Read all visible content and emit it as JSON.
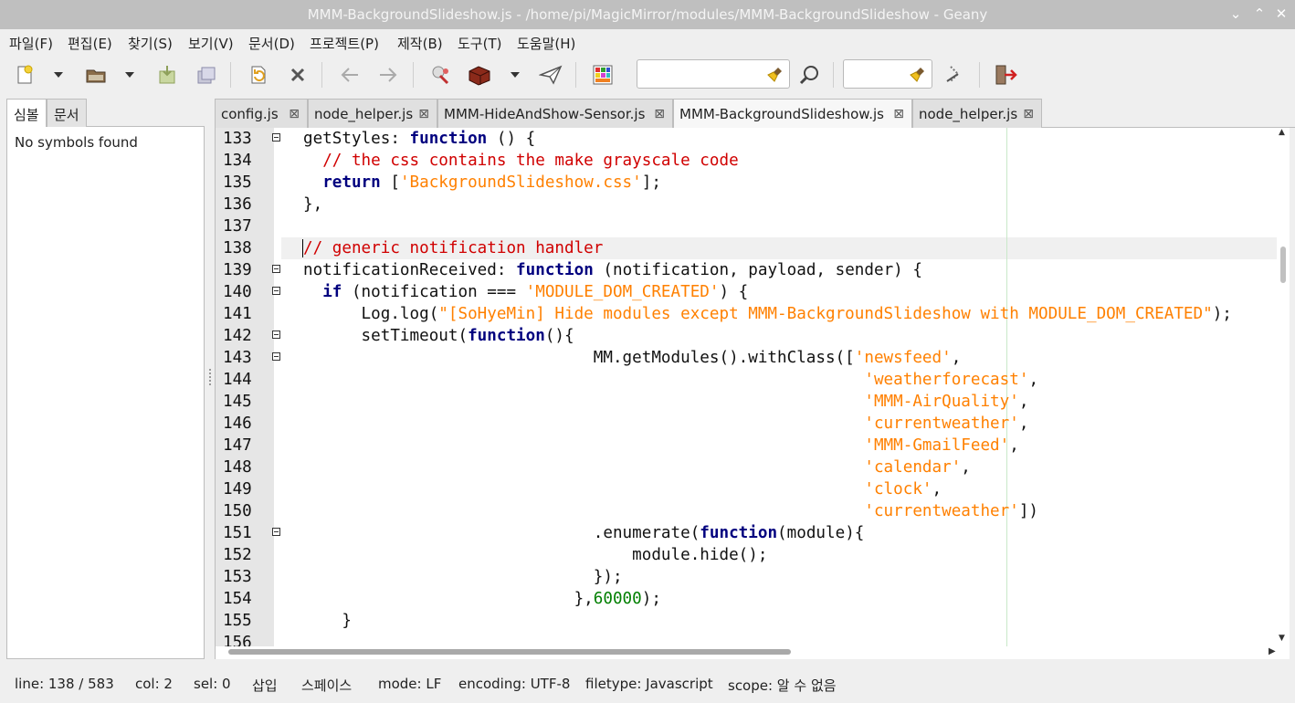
{
  "window": {
    "title": "MMM-BackgroundSlideshow.js - /home/pi/MagicMirror/modules/MMM-BackgroundSlideshow - Geany",
    "minimize_glyph": "⌄",
    "maximize_glyph": "⌃",
    "close_glyph": "✕"
  },
  "menu": [
    "파일(F)",
    "편집(E)",
    "찾기(S)",
    "보기(V)",
    "문서(D)",
    "프로젝트(P)",
    "제작(B)",
    "도구(T)",
    "도움말(H)"
  ],
  "toolbar": {
    "icons": [
      "new-file-icon",
      "dropdown-icon",
      "open-file-icon",
      "dropdown-icon",
      "save-icon",
      "save-all-icon",
      "revert-icon",
      "close-icon",
      "back-icon",
      "forward-icon",
      "compile-icon",
      "build-icon",
      "dropdown-icon",
      "execute-icon",
      "color-chooser-icon",
      "search-icon",
      "jump-to-line-icon",
      "quit-icon"
    ],
    "search_value": "",
    "goto_value": ""
  },
  "sidebar": {
    "tabs": [
      "심볼",
      "문서"
    ],
    "active_tab": 0,
    "empty_text": "No symbols found"
  },
  "tabs": [
    {
      "label": "config.js",
      "active": false
    },
    {
      "label": "node_helper.js",
      "active": false
    },
    {
      "label": "MMM-HideAndShow-Sensor.js",
      "active": false
    },
    {
      "label": "MMM-BackgroundSlideshow.js",
      "active": true
    },
    {
      "label": "node_helper.js",
      "active": false
    }
  ],
  "tab_close_glyph": "⊠",
  "editor": {
    "current_line": 138,
    "lines": [
      {
        "n": "133",
        "fold": true,
        "tokens": [
          [
            "",
            "getStyles: "
          ],
          [
            "kw",
            "function"
          ],
          [
            "",
            " () {"
          ]
        ]
      },
      {
        "n": "134",
        "fold": false,
        "tokens": [
          [
            "",
            "  "
          ],
          [
            "cm",
            "// the css contains the make grayscale code"
          ]
        ]
      },
      {
        "n": "135",
        "fold": false,
        "tokens": [
          [
            "",
            "  "
          ],
          [
            "kw",
            "return"
          ],
          [
            "",
            " ["
          ],
          [
            "st",
            "'BackgroundSlideshow.css'"
          ],
          [
            "",
            "];"
          ]
        ]
      },
      {
        "n": "136",
        "fold": false,
        "tokens": [
          [
            "",
            "},"
          ]
        ]
      },
      {
        "n": "137",
        "fold": false,
        "tokens": [
          [
            "",
            ""
          ]
        ]
      },
      {
        "n": "138",
        "fold": false,
        "tokens": [
          [
            "cm",
            "// generic notification handler"
          ]
        ]
      },
      {
        "n": "139",
        "fold": true,
        "tokens": [
          [
            "",
            "notificationReceived: "
          ],
          [
            "kw",
            "function"
          ],
          [
            "",
            " (notification, payload, sender) {"
          ]
        ]
      },
      {
        "n": "140",
        "fold": true,
        "tokens": [
          [
            "",
            "  "
          ],
          [
            "kw",
            "if"
          ],
          [
            "",
            " (notification === "
          ],
          [
            "st",
            "'MODULE_DOM_CREATED'"
          ],
          [
            "",
            ") {"
          ]
        ]
      },
      {
        "n": "141",
        "fold": false,
        "tokens": [
          [
            "",
            "      Log.log("
          ],
          [
            "st",
            "\"[SoHyeMin] Hide modules except MMM-BackgroundSlideshow with MODULE_DOM_CREATED\""
          ],
          [
            "",
            ");"
          ]
        ]
      },
      {
        "n": "142",
        "fold": true,
        "tokens": [
          [
            "",
            "      setTimeout("
          ],
          [
            "kw",
            "function"
          ],
          [
            "",
            "(){"
          ]
        ]
      },
      {
        "n": "143",
        "fold": true,
        "tokens": [
          [
            "",
            "                              MM.getModules().withClass(["
          ],
          [
            "st",
            "'newsfeed'"
          ],
          [
            "",
            ","
          ]
        ]
      },
      {
        "n": "144",
        "fold": false,
        "tokens": [
          [
            "",
            "                                                          "
          ],
          [
            "st",
            "'weatherforecast'"
          ],
          [
            "",
            ","
          ]
        ]
      },
      {
        "n": "145",
        "fold": false,
        "tokens": [
          [
            "",
            "                                                          "
          ],
          [
            "st",
            "'MMM-AirQuality'"
          ],
          [
            "",
            ","
          ]
        ]
      },
      {
        "n": "146",
        "fold": false,
        "tokens": [
          [
            "",
            "                                                          "
          ],
          [
            "st",
            "'currentweather'"
          ],
          [
            "",
            ","
          ]
        ]
      },
      {
        "n": "147",
        "fold": false,
        "tokens": [
          [
            "",
            "                                                          "
          ],
          [
            "st",
            "'MMM-GmailFeed'"
          ],
          [
            "",
            ","
          ]
        ]
      },
      {
        "n": "148",
        "fold": false,
        "tokens": [
          [
            "",
            "                                                          "
          ],
          [
            "st",
            "'calendar'"
          ],
          [
            "",
            ","
          ]
        ]
      },
      {
        "n": "149",
        "fold": false,
        "tokens": [
          [
            "",
            "                                                          "
          ],
          [
            "st",
            "'clock'"
          ],
          [
            "",
            ","
          ]
        ]
      },
      {
        "n": "150",
        "fold": false,
        "tokens": [
          [
            "",
            "                                                          "
          ],
          [
            "st",
            "'currentweather'"
          ],
          [
            "",
            "])"
          ]
        ]
      },
      {
        "n": "151",
        "fold": true,
        "tokens": [
          [
            "",
            "                              .enumerate("
          ],
          [
            "kw",
            "function"
          ],
          [
            "",
            "(module){"
          ]
        ]
      },
      {
        "n": "152",
        "fold": false,
        "tokens": [
          [
            "",
            "                                  module.hide();"
          ]
        ]
      },
      {
        "n": "153",
        "fold": false,
        "tokens": [
          [
            "",
            "                              });"
          ]
        ]
      },
      {
        "n": "154",
        "fold": false,
        "tokens": [
          [
            "",
            "                            },"
          ],
          [
            "nm",
            "60000"
          ],
          [
            "",
            ");"
          ]
        ]
      },
      {
        "n": "155",
        "fold": false,
        "tokens": [
          [
            "",
            "    }"
          ]
        ]
      },
      {
        "n": "156",
        "fold": false,
        "tokens": [
          [
            "",
            ""
          ]
        ]
      }
    ]
  },
  "status": {
    "line": "line: 138 / 583",
    "col": "col: 2",
    "sel": "sel: 0",
    "insert": "삽입",
    "indent": "스페이스",
    "mode": "mode: LF",
    "encoding": "encoding: UTF-8",
    "filetype": "filetype: Javascript",
    "scope": "scope: 알 수 없음"
  }
}
